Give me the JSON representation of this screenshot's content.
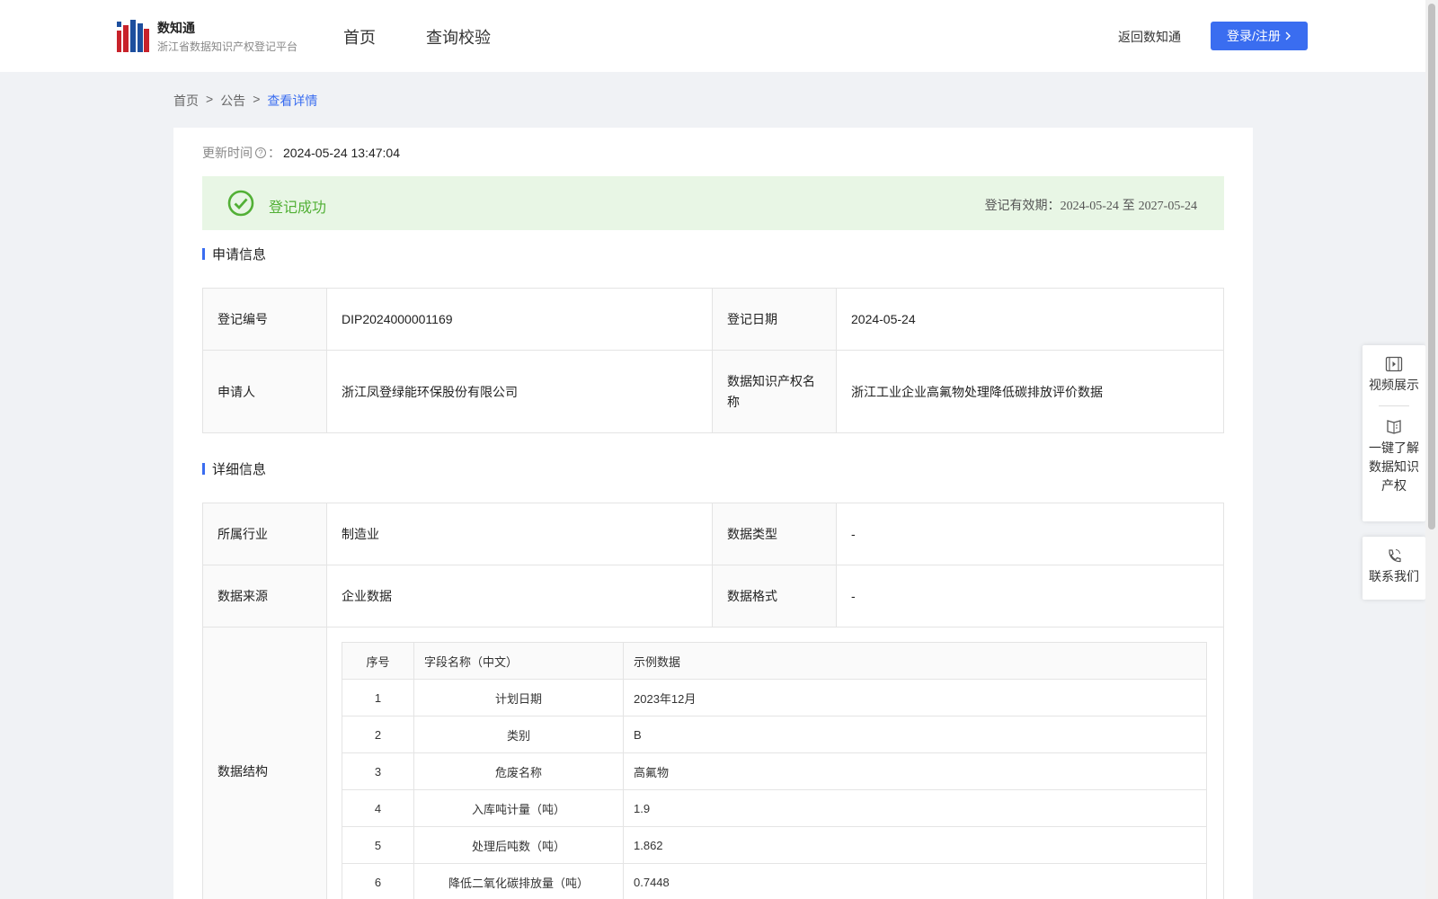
{
  "header": {
    "brand_name": "数知通",
    "brand_subtitle": "浙江省数据知识产权登记平台",
    "nav": [
      "首页",
      "查询校验"
    ],
    "back_link": "返回数知通",
    "login_button": "登录/注册"
  },
  "breadcrumb": [
    "首页",
    "公告",
    "查看详情"
  ],
  "breadcrumb_separator": ">",
  "update": {
    "label": "更新时间",
    "colon": "：",
    "value": "2024-05-24 13:47:04"
  },
  "status": {
    "text": "登记成功",
    "validity_label": "登记有效期：",
    "validity_start": "2024-05-24",
    "validity_sep": "至",
    "validity_end": "2027-05-24",
    "color": "#52b036"
  },
  "application": {
    "title": "申请信息",
    "reg_no_label": "登记编号",
    "reg_no": "DIP2024000001169",
    "reg_date_label": "登记日期",
    "reg_date": "2024-05-24",
    "applicant_label": "申请人",
    "applicant": "浙江凤登绿能环保股份有限公司",
    "ip_name_label": "数据知识产权名称",
    "ip_name": "浙江工业企业高氟物处理降低碳排放评价数据"
  },
  "details": {
    "title": "详细信息",
    "industry_label": "所属行业",
    "industry": "制造业",
    "data_type_label": "数据类型",
    "data_type": "-",
    "source_label": "数据来源",
    "source": "企业数据",
    "format_label": "数据格式",
    "format": "-",
    "structure_label": "数据结构",
    "columns": [
      "序号",
      "字段名称（中文）",
      "示例数据"
    ],
    "rows": [
      [
        "1",
        "计划日期",
        "2023年12月"
      ],
      [
        "2",
        "类别",
        "B"
      ],
      [
        "3",
        "危废名称",
        "高氟物"
      ],
      [
        "4",
        "入库吨计量（吨）",
        "1.9"
      ],
      [
        "5",
        "处理后吨数（吨）",
        "1.862"
      ],
      [
        "6",
        "降低二氧化碳排放量（吨）",
        "0.7448"
      ]
    ]
  },
  "float_panel": {
    "video": "视频展示",
    "learn": [
      "一键了解",
      "数据知识",
      "产权"
    ],
    "contact": "联系我们"
  },
  "colors": {
    "accent": "#3a6df0",
    "success_bg": "#e8f6e5",
    "page_bg": "#f0f2f5"
  }
}
